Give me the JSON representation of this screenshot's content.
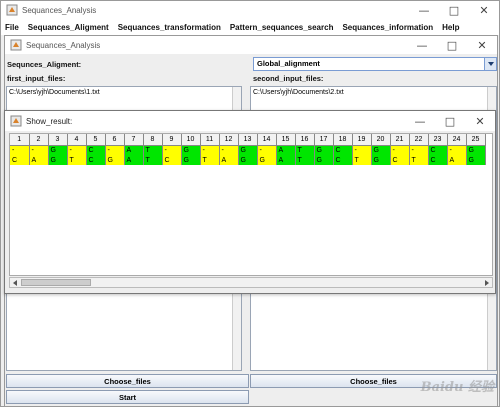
{
  "outer_window": {
    "title": "Sequances_Analysis",
    "menu": [
      "File",
      "Sequances_Aligment",
      "Sequances_transformation",
      "Pattern_sequances_search",
      "Sequances_information",
      "Help"
    ]
  },
  "inner_window": {
    "title": "Sequances_Analysis",
    "alignment_label": "Sequnces_Aligment:",
    "alignment_selected": "Global_alignment",
    "first_label": "first_input_files:",
    "second_label": "second_input_files:",
    "first_path": "C:\\Users\\yjh\\Documents\\1.txt",
    "second_path": "C:\\Users\\yjh\\Documents\\2.txt",
    "choose_left": "Choose_files",
    "choose_right": "Choose_files",
    "start": "Start"
  },
  "dialog": {
    "title": "Show_result:",
    "columns": [
      "1",
      "2",
      "3",
      "4",
      "5",
      "6",
      "7",
      "8",
      "9",
      "10",
      "11",
      "12",
      "13",
      "14",
      "15",
      "16",
      "17",
      "18",
      "19",
      "20",
      "21",
      "22",
      "23",
      "24",
      "25"
    ],
    "row1": [
      "-",
      "-",
      "G",
      "-",
      "C",
      "-",
      "A",
      "T",
      "-",
      "G",
      "-",
      "-",
      "G",
      "-",
      "A",
      "T",
      "G",
      "C",
      "-",
      "G",
      "-",
      "-",
      "C",
      "-",
      "G"
    ],
    "row2": [
      "C",
      "A",
      "G",
      "T",
      "C",
      "G",
      "A",
      "T",
      "C",
      "G",
      "T",
      "A",
      "G",
      "G",
      "A",
      "T",
      "G",
      "C",
      "T",
      "G",
      "C",
      "T",
      "C",
      "A",
      "G"
    ]
  },
  "colors": {
    "gap": "#ffff00",
    "match": "#00e600",
    "accent": "#7a9cd3"
  },
  "watermark": "Baidu 经验"
}
